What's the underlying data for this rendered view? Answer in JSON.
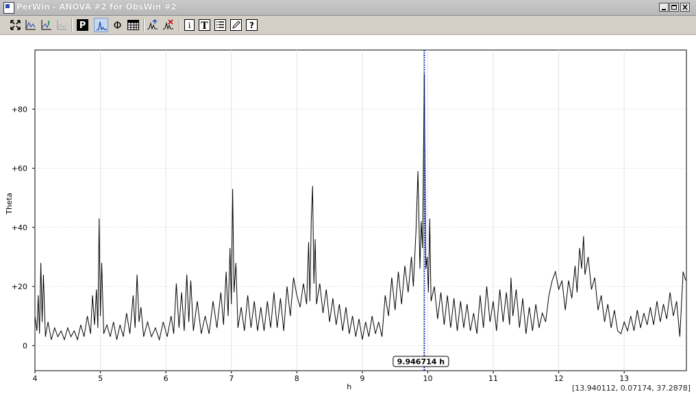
{
  "window": {
    "title": "PerWin - ANOVA #2 for ObsWin #2",
    "controls": [
      "minimize",
      "maximize",
      "close"
    ]
  },
  "toolbar": {
    "buttons": [
      {
        "name": "zoom-fit-icon",
        "active": false
      },
      {
        "name": "plot-axes-icon",
        "active": false
      },
      {
        "name": "plot-axes-alt-icon",
        "active": false
      },
      {
        "name": "plot-axes-disabled-icon",
        "active": false
      },
      {
        "name": "period-p-icon",
        "label": "P",
        "active": false
      },
      {
        "name": "periodogram-icon",
        "active": true
      },
      {
        "name": "phase-icon",
        "label": "Φ",
        "active": false
      },
      {
        "name": "table-icon",
        "active": false
      },
      {
        "name": "peak-mark-icon",
        "active": false
      },
      {
        "name": "peak-remove-icon",
        "active": false
      },
      {
        "name": "info-icon",
        "label": "i",
        "active": false
      },
      {
        "name": "text-icon",
        "label": "T",
        "active": false
      },
      {
        "name": "list-icon",
        "active": false
      },
      {
        "name": "edit-icon",
        "active": false
      },
      {
        "name": "help-icon",
        "label": "?",
        "active": false
      }
    ]
  },
  "chart_data": {
    "type": "line",
    "xlabel": "h",
    "ylabel": "Theta",
    "xlim": [
      4.0,
      13.95
    ],
    "ylim": [
      -8.5,
      100
    ],
    "xticks": [
      "4",
      "5",
      "6",
      "7",
      "8",
      "9",
      "10",
      "11",
      "12",
      "13"
    ],
    "yticks": [
      "0",
      "+20",
      "+40",
      "+60",
      "+80"
    ],
    "grid": true,
    "marker": {
      "x": 9.946714,
      "label": "9.946714 h",
      "color": "#1a2cb0"
    },
    "series": [
      {
        "color": "#000000",
        "points": [
          [
            4.0,
            10
          ],
          [
            4.03,
            5
          ],
          [
            4.05,
            17
          ],
          [
            4.07,
            4
          ],
          [
            4.09,
            28
          ],
          [
            4.11,
            8
          ],
          [
            4.13,
            24
          ],
          [
            4.16,
            3
          ],
          [
            4.2,
            8
          ],
          [
            4.25,
            2
          ],
          [
            4.3,
            6
          ],
          [
            4.35,
            3
          ],
          [
            4.4,
            5
          ],
          [
            4.45,
            2
          ],
          [
            4.5,
            6
          ],
          [
            4.55,
            3
          ],
          [
            4.6,
            5
          ],
          [
            4.65,
            2
          ],
          [
            4.7,
            7
          ],
          [
            4.75,
            3
          ],
          [
            4.8,
            10
          ],
          [
            4.85,
            4
          ],
          [
            4.88,
            17
          ],
          [
            4.91,
            7
          ],
          [
            4.94,
            19
          ],
          [
            4.96,
            6
          ],
          [
            4.98,
            43
          ],
          [
            5.0,
            10
          ],
          [
            5.02,
            28
          ],
          [
            5.05,
            4
          ],
          [
            5.1,
            7
          ],
          [
            5.15,
            3
          ],
          [
            5.2,
            8
          ],
          [
            5.25,
            2
          ],
          [
            5.3,
            7
          ],
          [
            5.35,
            3
          ],
          [
            5.4,
            11
          ],
          [
            5.45,
            4
          ],
          [
            5.5,
            17
          ],
          [
            5.53,
            6
          ],
          [
            5.56,
            24
          ],
          [
            5.59,
            8
          ],
          [
            5.62,
            13
          ],
          [
            5.66,
            3
          ],
          [
            5.72,
            8
          ],
          [
            5.78,
            3
          ],
          [
            5.84,
            6
          ],
          [
            5.9,
            2
          ],
          [
            5.96,
            8
          ],
          [
            6.02,
            3
          ],
          [
            6.08,
            10
          ],
          [
            6.12,
            4
          ],
          [
            6.16,
            21
          ],
          [
            6.2,
            6
          ],
          [
            6.24,
            18
          ],
          [
            6.28,
            5
          ],
          [
            6.32,
            24
          ],
          [
            6.35,
            8
          ],
          [
            6.38,
            22
          ],
          [
            6.42,
            5
          ],
          [
            6.48,
            15
          ],
          [
            6.54,
            4
          ],
          [
            6.6,
            10
          ],
          [
            6.66,
            4
          ],
          [
            6.72,
            15
          ],
          [
            6.78,
            6
          ],
          [
            6.84,
            18
          ],
          [
            6.88,
            7
          ],
          [
            6.92,
            25
          ],
          [
            6.95,
            10
          ],
          [
            6.98,
            33
          ],
          [
            7.0,
            14
          ],
          [
            7.02,
            53
          ],
          [
            7.04,
            18
          ],
          [
            7.07,
            28
          ],
          [
            7.1,
            6
          ],
          [
            7.15,
            13
          ],
          [
            7.2,
            5
          ],
          [
            7.25,
            17
          ],
          [
            7.3,
            6
          ],
          [
            7.35,
            15
          ],
          [
            7.4,
            5
          ],
          [
            7.45,
            13
          ],
          [
            7.5,
            5
          ],
          [
            7.55,
            15
          ],
          [
            7.6,
            6
          ],
          [
            7.65,
            18
          ],
          [
            7.7,
            6
          ],
          [
            7.75,
            16
          ],
          [
            7.8,
            5
          ],
          [
            7.85,
            20
          ],
          [
            7.9,
            10
          ],
          [
            7.95,
            23
          ],
          [
            8.0,
            17
          ],
          [
            8.05,
            13
          ],
          [
            8.1,
            21
          ],
          [
            8.15,
            14
          ],
          [
            8.18,
            35
          ],
          [
            8.2,
            15
          ],
          [
            8.22,
            42
          ],
          [
            8.24,
            54
          ],
          [
            8.26,
            21
          ],
          [
            8.28,
            36
          ],
          [
            8.3,
            14
          ],
          [
            8.35,
            21
          ],
          [
            8.4,
            11
          ],
          [
            8.45,
            19
          ],
          [
            8.5,
            8
          ],
          [
            8.55,
            16
          ],
          [
            8.6,
            7
          ],
          [
            8.65,
            14
          ],
          [
            8.7,
            5
          ],
          [
            8.75,
            13
          ],
          [
            8.8,
            4
          ],
          [
            8.85,
            10
          ],
          [
            8.9,
            3
          ],
          [
            8.95,
            9
          ],
          [
            9.0,
            2
          ],
          [
            9.05,
            8
          ],
          [
            9.1,
            3
          ],
          [
            9.15,
            10
          ],
          [
            9.2,
            4
          ],
          [
            9.25,
            8
          ],
          [
            9.3,
            3
          ],
          [
            9.35,
            17
          ],
          [
            9.4,
            10
          ],
          [
            9.45,
            23
          ],
          [
            9.5,
            12
          ],
          [
            9.55,
            25
          ],
          [
            9.6,
            14
          ],
          [
            9.65,
            27
          ],
          [
            9.7,
            18
          ],
          [
            9.75,
            30
          ],
          [
            9.78,
            20
          ],
          [
            9.82,
            39
          ],
          [
            9.85,
            59
          ],
          [
            9.88,
            26
          ],
          [
            9.9,
            42
          ],
          [
            9.92,
            33
          ],
          [
            9.947,
            92
          ],
          [
            9.97,
            26
          ],
          [
            9.99,
            30
          ],
          [
            10.01,
            18
          ],
          [
            10.03,
            43
          ],
          [
            10.05,
            15
          ],
          [
            10.1,
            20
          ],
          [
            10.15,
            9
          ],
          [
            10.2,
            18
          ],
          [
            10.25,
            7
          ],
          [
            10.3,
            17
          ],
          [
            10.35,
            6
          ],
          [
            10.4,
            16
          ],
          [
            10.45,
            5
          ],
          [
            10.5,
            15
          ],
          [
            10.55,
            6
          ],
          [
            10.6,
            14
          ],
          [
            10.65,
            5
          ],
          [
            10.7,
            11
          ],
          [
            10.75,
            4
          ],
          [
            10.8,
            17
          ],
          [
            10.85,
            6
          ],
          [
            10.9,
            20
          ],
          [
            10.95,
            8
          ],
          [
            11.0,
            15
          ],
          [
            11.05,
            5
          ],
          [
            11.1,
            19
          ],
          [
            11.15,
            8
          ],
          [
            11.2,
            18
          ],
          [
            11.25,
            7
          ],
          [
            11.27,
            23
          ],
          [
            11.3,
            10
          ],
          [
            11.35,
            19
          ],
          [
            11.4,
            6
          ],
          [
            11.45,
            16
          ],
          [
            11.5,
            4
          ],
          [
            11.55,
            13
          ],
          [
            11.6,
            5
          ],
          [
            11.65,
            14
          ],
          [
            11.7,
            6
          ],
          [
            11.75,
            11
          ],
          [
            11.8,
            8
          ],
          [
            11.85,
            17
          ],
          [
            11.9,
            22
          ],
          [
            11.95,
            25
          ],
          [
            12.0,
            19
          ],
          [
            12.05,
            22
          ],
          [
            12.1,
            12
          ],
          [
            12.15,
            22
          ],
          [
            12.2,
            16
          ],
          [
            12.25,
            27
          ],
          [
            12.28,
            18
          ],
          [
            12.32,
            33
          ],
          [
            12.35,
            26
          ],
          [
            12.38,
            37
          ],
          [
            12.4,
            24
          ],
          [
            12.45,
            30
          ],
          [
            12.5,
            19
          ],
          [
            12.55,
            23
          ],
          [
            12.6,
            12
          ],
          [
            12.65,
            17
          ],
          [
            12.7,
            8
          ],
          [
            12.75,
            14
          ],
          [
            12.8,
            6
          ],
          [
            12.85,
            12
          ],
          [
            12.9,
            5
          ],
          [
            12.95,
            4
          ],
          [
            13.0,
            8
          ],
          [
            13.05,
            5
          ],
          [
            13.1,
            10
          ],
          [
            13.15,
            5
          ],
          [
            13.2,
            12
          ],
          [
            13.25,
            6
          ],
          [
            13.3,
            11
          ],
          [
            13.35,
            7
          ],
          [
            13.4,
            13
          ],
          [
            13.45,
            7
          ],
          [
            13.5,
            15
          ],
          [
            13.55,
            8
          ],
          [
            13.6,
            14
          ],
          [
            13.65,
            9
          ],
          [
            13.7,
            18
          ],
          [
            13.75,
            10
          ],
          [
            13.8,
            15
          ],
          [
            13.85,
            3
          ],
          [
            13.9,
            25
          ],
          [
            13.94,
            22
          ]
        ]
      }
    ]
  },
  "status": {
    "coordinates": "[13.940112, 0.07174, 37.2878]"
  }
}
